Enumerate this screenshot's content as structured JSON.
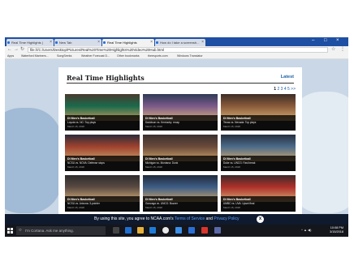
{
  "browser": {
    "tabs": [
      {
        "label": "Real Time Highlights |",
        "active": false
      },
      {
        "label": "New Tab",
        "active": false
      },
      {
        "label": "Real Time Highlights",
        "active": true
      },
      {
        "label": "How do I take a screensh...",
        "active": false
      }
    ],
    "url": "file:///C:/Users/Desktop/Pictures/Real%20Time%20Highlights%20Video%20Hub.html",
    "bookmarks": [
      "Apps",
      "Waterford Mariners...",
      "SongSeeks",
      "Weather Forecast D...",
      "Other bookmarks",
      "theesports.com",
      "Windows Translator"
    ]
  },
  "page": {
    "title": "Real Time Highlights",
    "latest_link": "Latest",
    "pager": {
      "current": "1",
      "others": [
        "2",
        "3",
        "4",
        "5",
        ">>"
      ]
    },
    "videos": [
      {
        "league": "DI Men's Basketball",
        "headline": "Loyola vs. NC: Top plays",
        "date": "March 15, 2018"
      },
      {
        "league": "DI Men's Basketball",
        "headline": "Davidson vs. Kentucky: recap",
        "date": "March 15, 2018"
      },
      {
        "league": "DI Men's Basketball",
        "headline": "Texas vs. Nevada: Top plays",
        "date": "March 15, 2018"
      },
      {
        "league": "DI Men's Basketball",
        "headline": "NCSU vs. NOVA: Defense stops",
        "date": "March 15, 2018"
      },
      {
        "league": "DI Men's Basketball",
        "headline": "Michigan vs. Montana: Dunk",
        "date": "March 15, 2018"
      },
      {
        "league": "DI Men's Basketball",
        "headline": "Duke vs. UNCG: Fast break",
        "date": "March 15, 2018"
      },
      {
        "league": "DI Men's Basketball",
        "headline": "NCSU vs. Arizona: 3-pointer",
        "date": "March 15, 2018"
      },
      {
        "league": "DI Men's Basketball",
        "headline": "Gonzaga vs. UNCG: Buzzer",
        "date": "March 15, 2018"
      },
      {
        "league": "DI Men's Basketball",
        "headline": "UMBC vs. UVA: Upset final",
        "date": "March 15, 2018"
      }
    ],
    "cookie": {
      "prefix": "By using this site, you agree to NCAA.com's",
      "terms": "Terms of Service",
      "and": "and",
      "privacy": "Privacy Policy",
      "close": "x"
    }
  },
  "taskbar": {
    "search_placeholder": "I'm Cortana. Ask me anything.",
    "clock_time": "10:08 PM",
    "clock_date": "3/15/2018"
  },
  "colors": {
    "accent": "#1b5fa8",
    "tab_strip": "#1e4fa3",
    "cookie_bar": "#0f1a2e",
    "taskbar": "#14161c"
  }
}
